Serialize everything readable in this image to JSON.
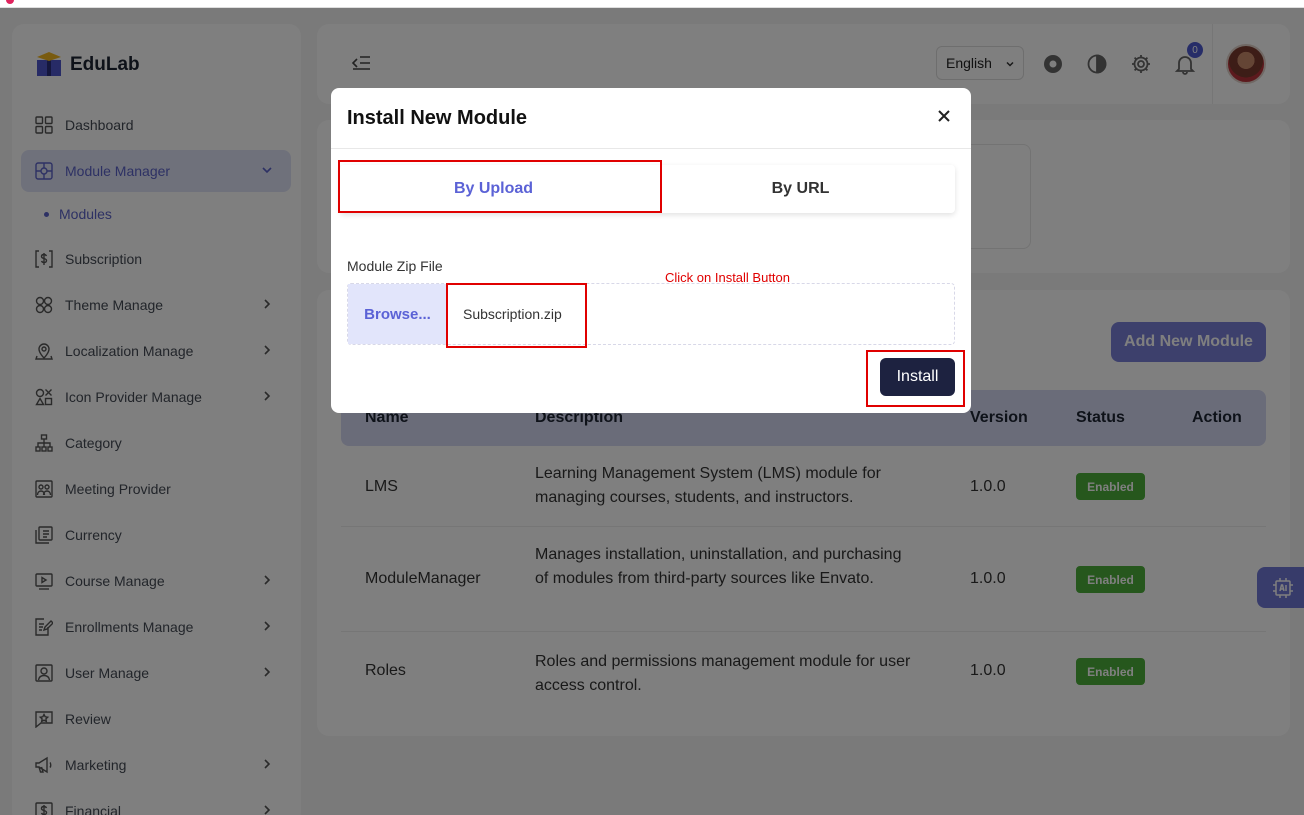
{
  "brand": {
    "name": "EduLab"
  },
  "sidebar": {
    "items": [
      {
        "label": "Dashboard",
        "icon": "grid-icon"
      },
      {
        "label": "Module Manager",
        "icon": "module-icon"
      },
      {
        "label": "Subscription",
        "icon": "dollar-icon"
      },
      {
        "label": "Theme Manage",
        "icon": "theme-icon"
      },
      {
        "label": "Localization Manage",
        "icon": "location-icon"
      },
      {
        "label": "Icon Provider Manage",
        "icon": "shapes-icon"
      },
      {
        "label": "Category",
        "icon": "hierarchy-icon"
      },
      {
        "label": "Meeting Provider",
        "icon": "meeting-icon"
      },
      {
        "label": "Currency",
        "icon": "currency-icon"
      },
      {
        "label": "Course Manage",
        "icon": "video-icon"
      },
      {
        "label": "Enrollments Manage",
        "icon": "edit-doc-icon"
      },
      {
        "label": "User Manage",
        "icon": "user-icon"
      },
      {
        "label": "Review",
        "icon": "review-icon"
      },
      {
        "label": "Marketing",
        "icon": "megaphone-icon"
      },
      {
        "label": "Financial",
        "icon": "financial-icon"
      }
    ],
    "subitem": "Modules"
  },
  "header": {
    "language": "English",
    "notification_count": "0"
  },
  "main": {
    "add_button": "Add New Module",
    "columns": [
      "Name",
      "Description",
      "Version",
      "Status",
      "Action"
    ],
    "rows": [
      {
        "name": "LMS",
        "description": "Learning Management System (LMS) module for managing courses, students, and instructors.",
        "version": "1.0.0",
        "status": "Enabled"
      },
      {
        "name": "ModuleManager",
        "description": "Manages installation, uninstallation, and purchasing of modules from third-party sources like Envato.",
        "version": "1.0.0",
        "status": "Enabled"
      },
      {
        "name": "Roles",
        "description": "Roles and permissions management module for user access control.",
        "version": "1.0.0",
        "status": "Enabled"
      }
    ]
  },
  "modal": {
    "title": "Install New Module",
    "tab_upload": "By Upload",
    "tab_url": "By URL",
    "field_label": "Module Zip File",
    "browse_label": "Browse...",
    "file_name": "Subscription.zip",
    "install_label": "Install"
  },
  "annotation": {
    "text": "Click on Install Button",
    "color": "#e00000"
  },
  "colors": {
    "accent": "#5b62d6",
    "install": "#1d2240",
    "enabled": "#4caf3a"
  }
}
